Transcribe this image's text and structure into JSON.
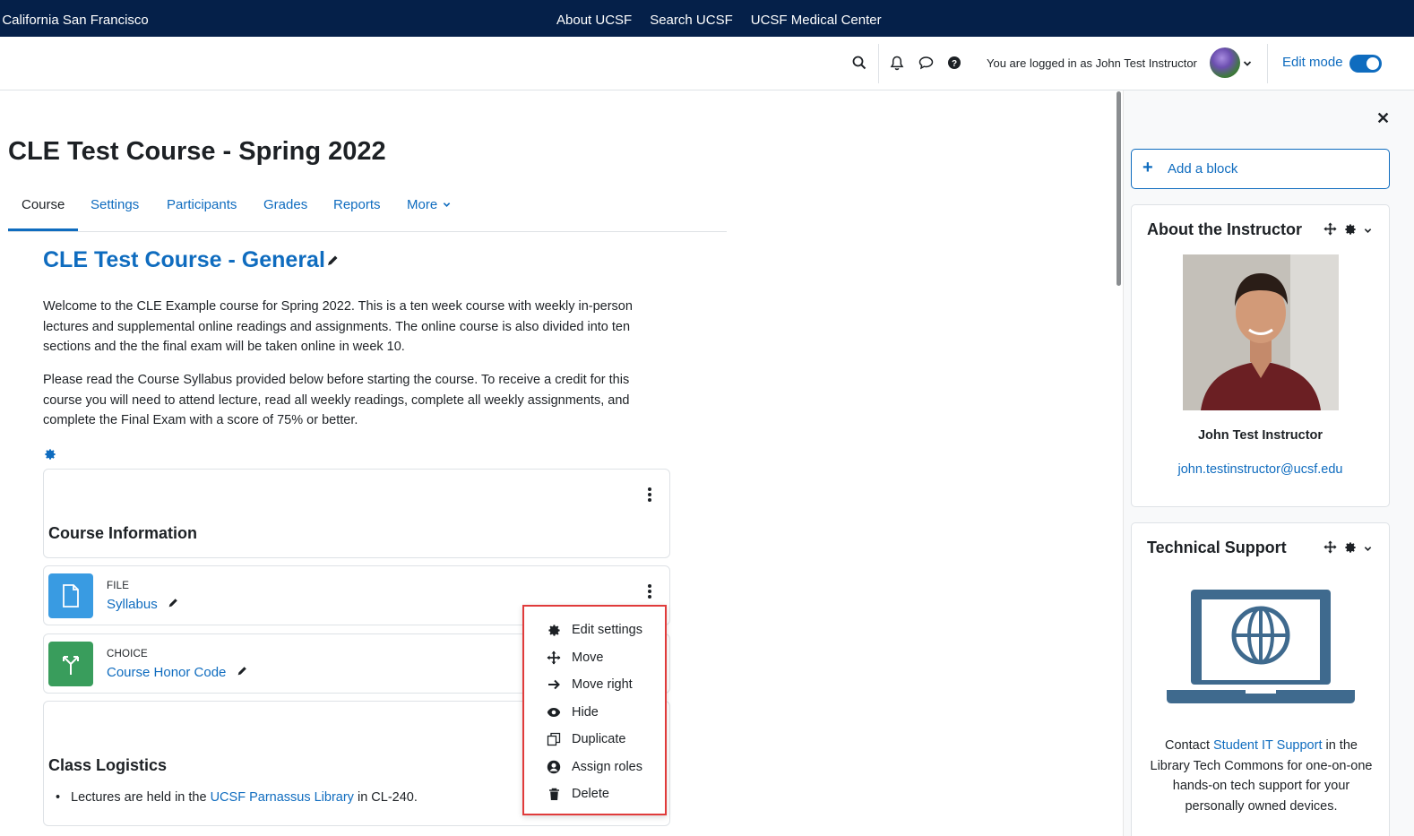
{
  "ucsf_bar": {
    "brand": "f California San Francisco",
    "links": [
      "About UCSF",
      "Search UCSF",
      "UCSF Medical Center"
    ]
  },
  "navbar": {
    "login_text": "You are logged in as John Test Instructor",
    "edit_mode_label": "Edit mode",
    "edit_mode_on": true
  },
  "course": {
    "title": "CLE Test Course - Spring 2022",
    "tabs": [
      "Course",
      "Settings",
      "Participants",
      "Grades",
      "Reports",
      "More"
    ],
    "active_tab": "Course"
  },
  "section": {
    "title": "CLE Test Course - General",
    "paragraphs": [
      "Welcome to the CLE Example course for Spring 2022. This is a ten week course with weekly in-person lectures and supplemental online readings and assignments. The online course is also divided into ten sections and the the final exam will be taken online in week 10.",
      "Please read the Course Syllabus provided below before starting the course. To receive a credit for this course you will need to attend lecture, read all weekly readings, complete all weekly assignments, and complete the Final Exam with a score of 75% or better."
    ]
  },
  "activities": {
    "course_info_heading": "Course Information",
    "file": {
      "type": "File",
      "name": "Syllabus",
      "color": "#399be2"
    },
    "choice": {
      "type": "Choice",
      "name": "Course Honor Code",
      "color": "#399d5c"
    },
    "class_logistics_heading": "Class Logistics",
    "logistics_prefix": "Lectures are held in the ",
    "logistics_link": "UCSF Parnassus Library",
    "logistics_suffix": " in CL-240."
  },
  "dropdown": {
    "items": [
      "Edit settings",
      "Move",
      "Move right",
      "Hide",
      "Duplicate",
      "Assign roles",
      "Delete"
    ],
    "icons": [
      "gear-icon",
      "move-icon",
      "arrow-right-icon",
      "eye-icon",
      "copy-icon",
      "user-circle-icon",
      "trash-icon"
    ],
    "highlight_color": "#e03b3b"
  },
  "drawer": {
    "add_block_label": "Add a block",
    "about": {
      "title": "About the Instructor",
      "name": "John Test Instructor",
      "email": "john.testinstructor@ucsf.edu"
    },
    "support": {
      "title": "Technical Support",
      "text_prefix": "Contact ",
      "link": "Student IT Support",
      "text_suffix": " in the Library Tech Commons for one-on-one hands-on tech support for your personally owned devices."
    }
  },
  "colors": {
    "ucsf_navy": "#052049",
    "link_blue": "#0f6cbf"
  }
}
